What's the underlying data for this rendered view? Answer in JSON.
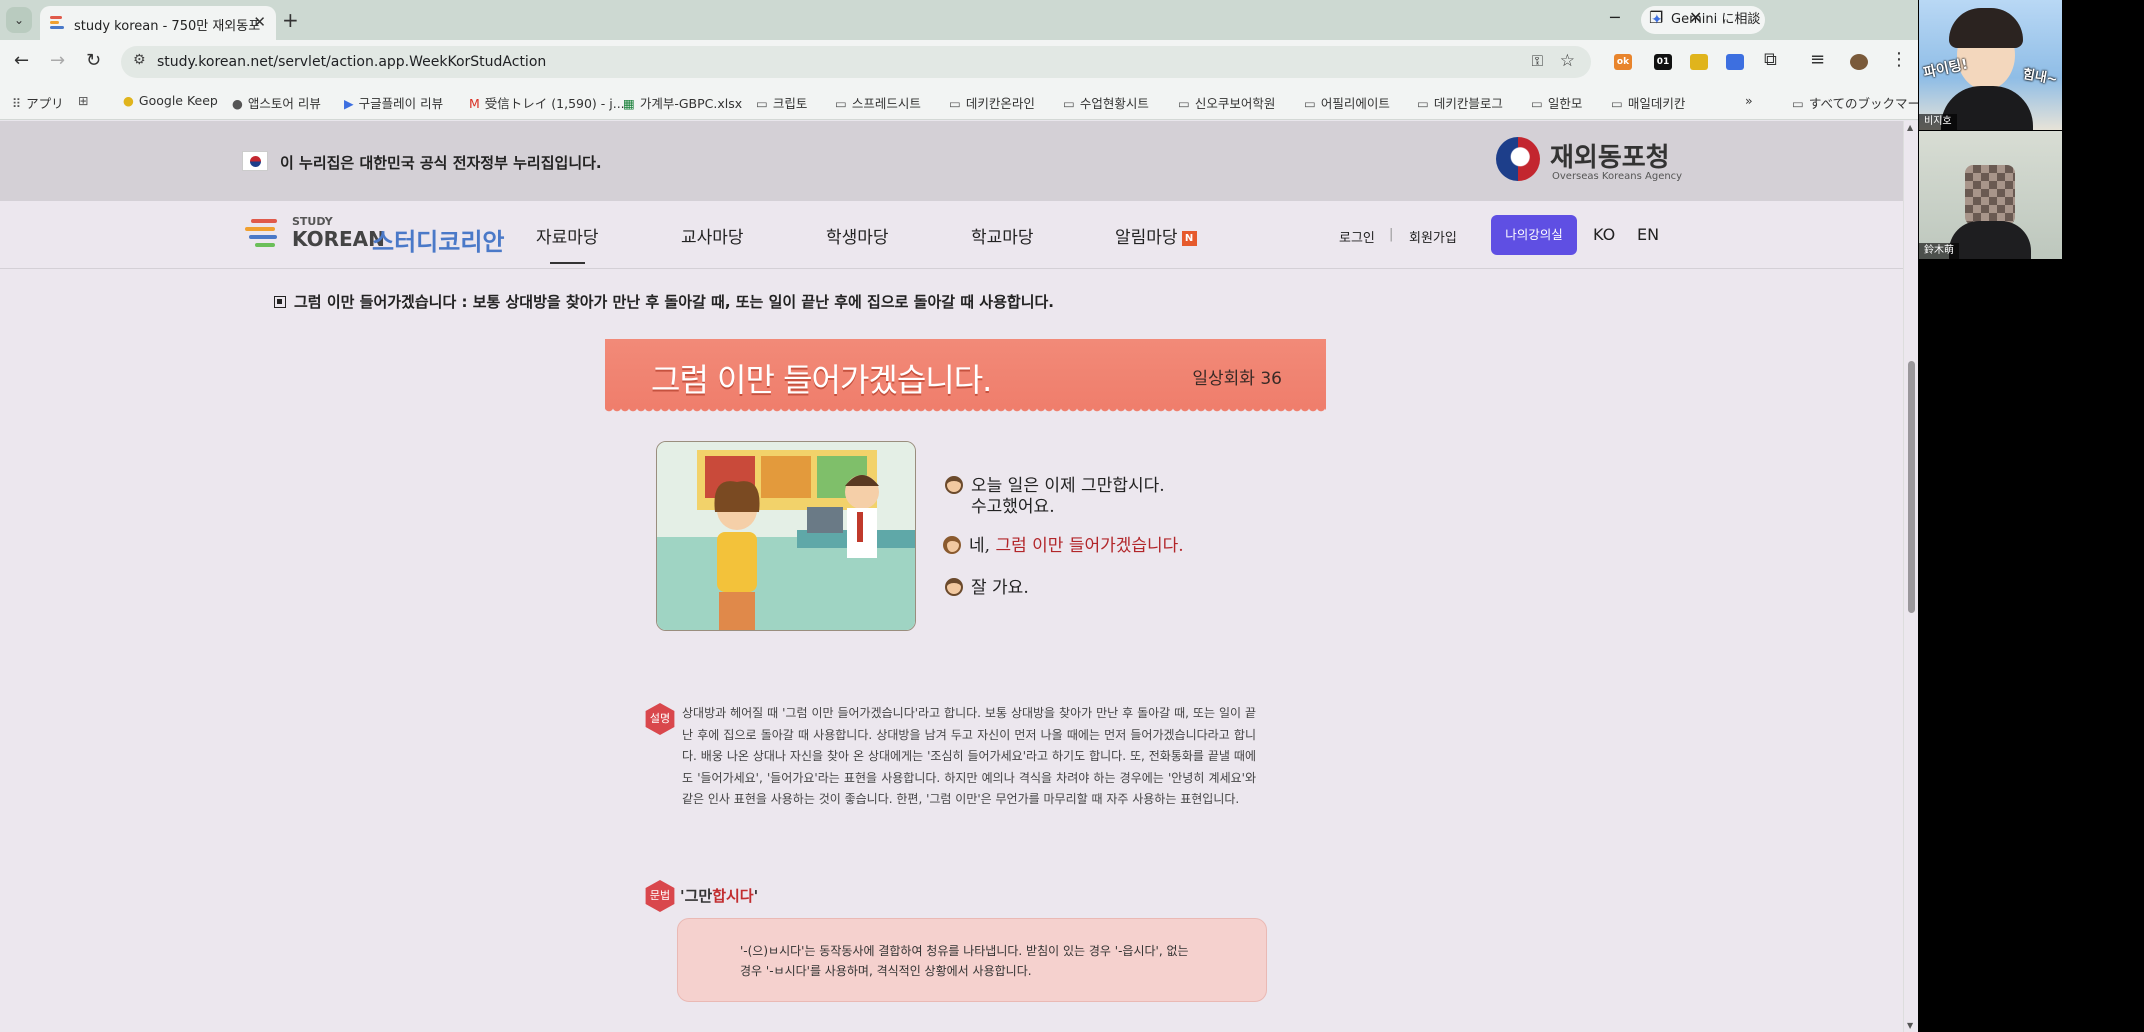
{
  "browser": {
    "tab_title": "study korean - 750만 재외동포",
    "tab_close": "✕",
    "new_tab": "+",
    "gemini_label": "Gemini に相談",
    "window_controls": {
      "minimize": "─",
      "restore": "❐",
      "close": "✕"
    },
    "url": "study.korean.net/servlet/action.app.WeekKorStudAction",
    "extensions": [
      "ok",
      "01"
    ]
  },
  "bookmarks": {
    "items": [
      {
        "icon": "apps-grid-icon",
        "label": "アプリ"
      },
      {
        "icon": "tab-groups-icon",
        "label": ""
      },
      {
        "icon": "google-keep-icon",
        "label": "Google Keep"
      },
      {
        "icon": "apple-icon",
        "label": "앱스토어 리뷰"
      },
      {
        "icon": "google-play-icon",
        "label": "구글플레이 리뷰"
      },
      {
        "icon": "gmail-icon",
        "label": "受信トレイ (1,590) - j..."
      },
      {
        "icon": "sheets-icon",
        "label": "가계부-GBPC.xlsx"
      },
      {
        "icon": "folder-icon",
        "label": "크립토"
      },
      {
        "icon": "folder-icon",
        "label": "스프레드시트"
      },
      {
        "icon": "folder-icon",
        "label": "데키칸온라인"
      },
      {
        "icon": "folder-icon",
        "label": "수업현황시트"
      },
      {
        "icon": "folder-icon",
        "label": "신오쿠보어학원"
      },
      {
        "icon": "folder-icon",
        "label": "어필리에이트"
      },
      {
        "icon": "folder-icon",
        "label": "데키칸블로그"
      },
      {
        "icon": "folder-icon",
        "label": "일한모"
      },
      {
        "icon": "folder-icon",
        "label": "매일데키칸"
      }
    ],
    "more": "»",
    "all_bookmarks": "すべてのブックマーク"
  },
  "gov_bar": {
    "notice": "이 누리집은 대한민국 공식 전자정부 누리집입니다.",
    "agency_name": "재외동포청",
    "agency_sub": "Overseas Koreans Agency"
  },
  "site_nav": {
    "logo_study": "STUDY",
    "logo_korean": "KOREAN",
    "logo_name": "스터디코리안",
    "menu": [
      "자료마당",
      "교사마당",
      "학생마당",
      "학교마당",
      "알림마당"
    ],
    "new_badge": "N",
    "login": "로그인",
    "divider": "|",
    "signup": "회원가입",
    "my_lecture": "나의강의실",
    "lang_ko": "KO",
    "lang_en": "EN"
  },
  "lesson": {
    "intro": "그럼 이만 들어가겠습니다 : 보통 상대방을 찾아가 만난 후 돌아갈 때, 또는 일이 끝난 후에 집으로 돌아갈 때 사용합니다.",
    "banner_title": "그럼 이만 들어가겠습니다.",
    "banner_tag": "일상회화 36",
    "dialogue": {
      "l1a": "오늘 일은 이제 그만합시다.",
      "l1b": "수고했어요.",
      "l2_prefix": "네, ",
      "l2_highlight": "그럼 이만 들어가겠습니다.",
      "l3": "잘 가요."
    },
    "explain_badge": "설명",
    "explanation": "상대방과 헤어질 때 '그럼 이만 들어가겠습니다'라고 합니다. 보통 상대방을 찾아가 만난 후 돌아갈 때, 또는 일이 끝난 후에 집으로 돌아갈 때 사용합니다. 상대방을 남겨 두고 자신이 먼저 나올 때에는 먼저 들어가겠습니다라고 합니다. 배웅 나온 상대나 자신을 찾아 온 상대에게는 '조심히 들어가세요'라고 하기도 합니다. 또, 전화통화를 끝낼 때에도 '들어가세요', '들어가요'라는 표현을 사용합니다. 하지만 예의나 격식을 차려야 하는 경우에는 '안녕히 계세요'와 같은 인사 표현을 사용하는 것이 좋습니다. 한편, '그럼 이만'은 무언가를 마무리할 때 자주 사용하는 표현입니다.",
    "grammar_badge": "문법",
    "grammar_title_prefix": "'그만",
    "grammar_title_highlight": "합시다",
    "grammar_title_suffix": "'",
    "grammar_body": "'-(으)ㅂ시다'는 동작동사에 결합하여 청유를 나타냅니다. 받침이 있는 경우 '-읍시다', 없는 경우 '-ㅂ시다'를 사용하며, 격식적인 상황에서 사용합니다."
  },
  "video_call": {
    "participants": [
      {
        "name": "비지호",
        "sticker_left": "파이팅!",
        "sticker_right": "힘내~"
      },
      {
        "name": "鈴木萌"
      }
    ]
  },
  "colors": {
    "banner": "#ef7e6c",
    "highlight": "#b2262a",
    "primary_button": "#5f4fe3",
    "grammar_box": "#f5d1ce"
  }
}
